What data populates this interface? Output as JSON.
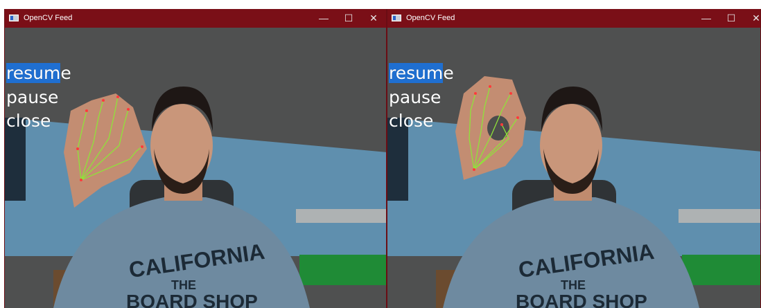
{
  "windows": [
    {
      "title": "OpenCV Feed",
      "controls": {
        "minimize": "—",
        "maximize": "☐",
        "close": "✕"
      },
      "menu": {
        "resume": {
          "highlighted": "resum",
          "rest": "e"
        },
        "pause": "pause",
        "close": "close"
      },
      "gesture": "open-palm",
      "shirt_text": [
        "CALIFORNIA",
        "THE",
        "BOARD SHOP"
      ]
    },
    {
      "title": "OpenCV Feed",
      "controls": {
        "minimize": "—",
        "maximize": "☐",
        "close": "✕"
      },
      "menu": {
        "resume": {
          "highlighted": "resum",
          "rest": "e"
        },
        "pause": "pause",
        "close": "close"
      },
      "gesture": "ok-sign",
      "shirt_text": [
        "CALIFORNIA",
        "THE",
        "BOARD SHOP"
      ]
    }
  ],
  "colors": {
    "titlebar": "#7a0f17",
    "highlight": "#1f6fd1",
    "landmarks": "#8fe33a",
    "shirt": "#6e8aa0"
  }
}
